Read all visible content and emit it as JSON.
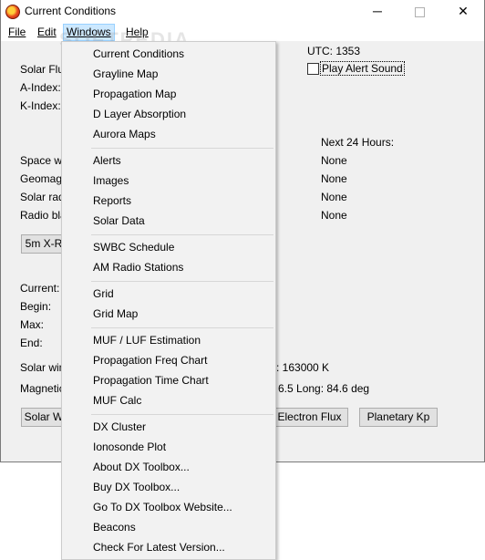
{
  "window": {
    "title": "Current Conditions",
    "controls": {
      "minimize": "─",
      "close": "✕"
    }
  },
  "menubar": {
    "file": "File",
    "edit": "Edit",
    "windows": "Windows",
    "help": "Help"
  },
  "watermark": "SOFTPEDIA",
  "main": {
    "utc": "UTC: 1353",
    "play_alert_sound": "Play Alert Sound",
    "labels": {
      "solar_flux": "Solar Flux:",
      "a_index": "A-Index:",
      "k_index": "K-Index:",
      "space_weather": "Space we",
      "geomag": "Geomag",
      "solar_rad": "Solar rad",
      "radio_bla": "Radio bla",
      "current": "Current:",
      "begin": "Begin:",
      "max": "Max:",
      "end": "End:",
      "solar_wind": "Solar win",
      "magnetic": "Magnetic"
    },
    "next_24_hours": {
      "heading": "Next 24 Hours:",
      "values": [
        "None",
        "None",
        "None",
        "None"
      ]
    },
    "xray_button": "5m X-R",
    "solar_wind_value": ": 163000 K",
    "magnetic_value": "6.5  Long: 84.6 deg",
    "bottom_buttons": {
      "solar_wind": "Solar W",
      "electron_flux": "Electron Flux",
      "planetary_kp": "Planetary Kp"
    }
  },
  "windows_menu": {
    "groups": [
      [
        "Current Conditions",
        "Grayline Map",
        "Propagation Map",
        "D Layer Absorption",
        "Aurora Maps"
      ],
      [
        "Alerts",
        "Images",
        "Reports",
        "Solar Data"
      ],
      [
        "SWBC Schedule",
        "AM Radio Stations"
      ],
      [
        "Grid",
        "Grid Map"
      ],
      [
        "MUF / LUF Estimation",
        "Propagation Freq Chart",
        "Propagation Time Chart",
        "MUF Calc"
      ],
      [
        "DX Cluster",
        "Ionosonde Plot",
        "About DX Toolbox...",
        "Buy DX Toolbox...",
        "Go To DX Toolbox Website...",
        "Beacons",
        "Check For Latest Version..."
      ]
    ]
  }
}
